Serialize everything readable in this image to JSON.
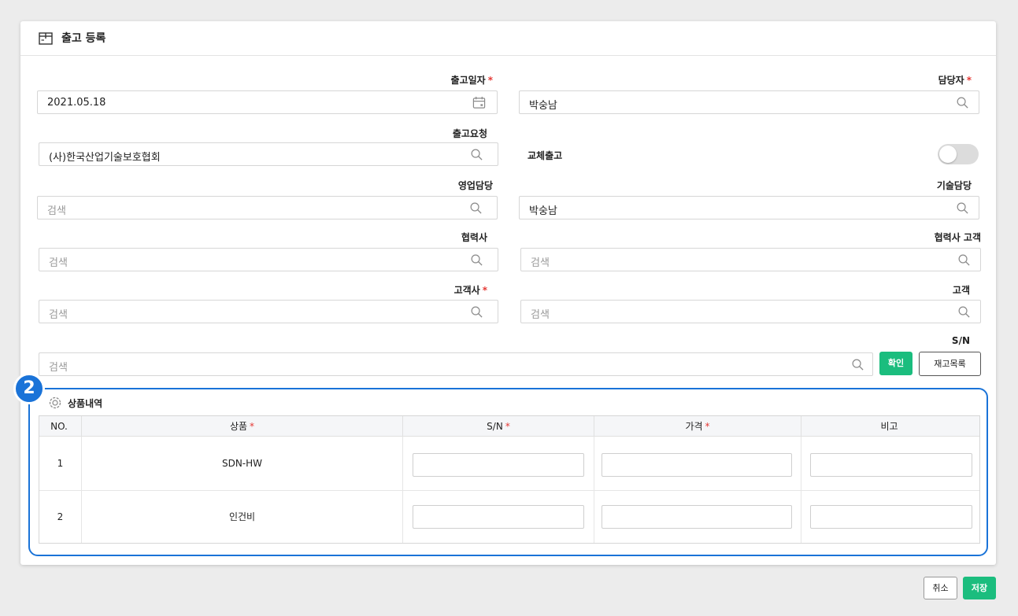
{
  "panel": {
    "title": "출고 등록"
  },
  "form": {
    "ship_date": {
      "label": "출고일자",
      "required": "*",
      "value": "2021.05.18"
    },
    "manager": {
      "label": "담당자",
      "required": "*",
      "value": "박숭남"
    },
    "ship_request": {
      "label": "출고요청",
      "value": "(사)한국산업기술보호협회"
    },
    "replace_ship": {
      "label": "교체출고",
      "enabled": false
    },
    "sales_manager": {
      "label": "영업담당",
      "placeholder": "검색"
    },
    "tech_manager": {
      "label": "기술담당",
      "value": "박숭남"
    },
    "partner": {
      "label": "협력사",
      "placeholder": "검색"
    },
    "partner_customer": {
      "label": "협력사 고객",
      "placeholder": "검색"
    },
    "customer_company": {
      "label": "고객사",
      "required": "*",
      "placeholder": "검색"
    },
    "customer": {
      "label": "고객",
      "placeholder": "검색"
    },
    "sn": {
      "label": "S/N",
      "placeholder": "검색",
      "confirm_label": "확인",
      "inventory_label": "재고목록"
    }
  },
  "section": {
    "badge": "2",
    "title": "상품내역",
    "columns": [
      {
        "label": "NO.",
        "required": ""
      },
      {
        "label": "상품",
        "required": "*"
      },
      {
        "label": "S/N",
        "required": "*"
      },
      {
        "label": "가격",
        "required": "*"
      },
      {
        "label": "비고",
        "required": ""
      }
    ],
    "rows": [
      {
        "no": "1",
        "product": "SDN-HW"
      },
      {
        "no": "2",
        "product": "인건비"
      }
    ]
  },
  "footer": {
    "cancel_label": "취소",
    "save_label": "저장"
  },
  "colors": {
    "accent_green": "#1bbd7e",
    "highlight_blue": "#1a73d8",
    "required_red": "#e53935"
  },
  "icons": {
    "header": "box-icon",
    "calendar": "calendar-icon",
    "search": "search-icon",
    "section": "gear-icon"
  }
}
